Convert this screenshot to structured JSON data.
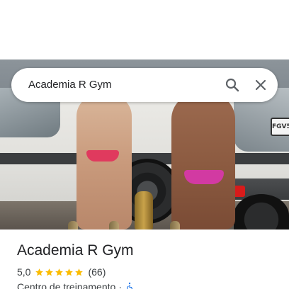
{
  "search": {
    "query": "Academia R Gym"
  },
  "place": {
    "name": "Academia R Gym",
    "rating": "5,0",
    "stars_filled": 5,
    "reviews": "(66)",
    "category": "Centro de treinamento",
    "separator": "·"
  },
  "photo": {
    "plate_text": "FGV5"
  },
  "colors": {
    "star": "#fbbc04",
    "accessibility": "#1a73e8",
    "text_primary": "#202124",
    "text_secondary": "#3c4043"
  },
  "icons": {
    "search": "search-icon",
    "close": "close-icon",
    "star": "star-icon",
    "accessibility": "wheelchair-icon"
  }
}
